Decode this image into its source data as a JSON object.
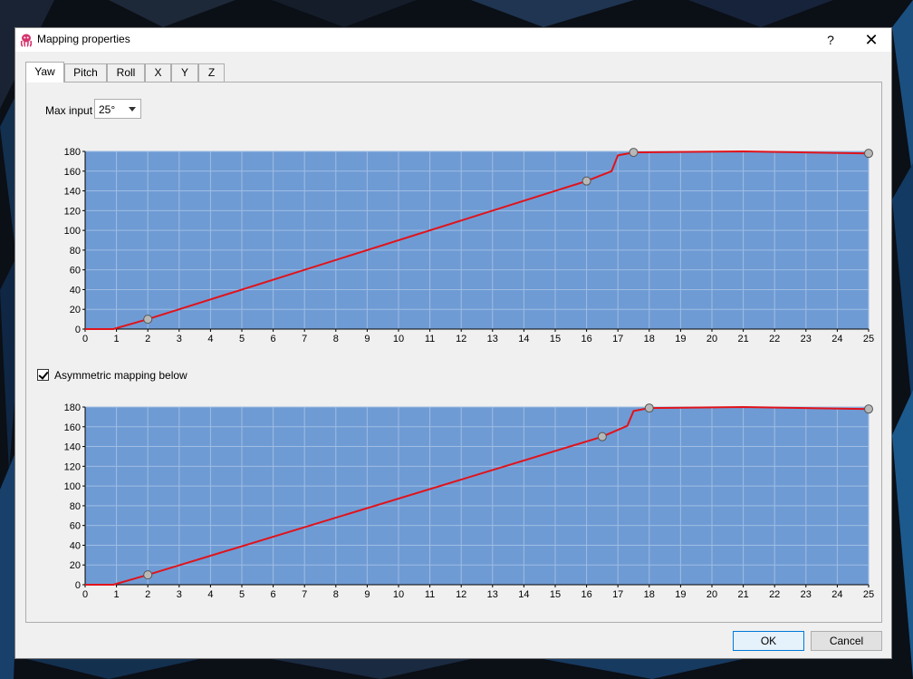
{
  "window": {
    "title": "Mapping properties",
    "help_label": "?",
    "close_label": "✕"
  },
  "tabs": [
    {
      "label": "Yaw",
      "active": true
    },
    {
      "label": "Pitch",
      "active": false
    },
    {
      "label": "Roll",
      "active": false
    },
    {
      "label": "X",
      "active": false
    },
    {
      "label": "Y",
      "active": false
    },
    {
      "label": "Z",
      "active": false
    }
  ],
  "max_input": {
    "label": "Max input",
    "value": "25°"
  },
  "asymmetric": {
    "label": "Asymmetric mapping below",
    "checked": true
  },
  "buttons": {
    "ok": "OK",
    "cancel": "Cancel"
  },
  "colors": {
    "plot_bg": "#6f9bd4",
    "curve": "#e0131b",
    "grid": "#9ebde4",
    "handle": "#b8b8b8"
  },
  "chart_data": [
    {
      "type": "line",
      "xlim": [
        0,
        25
      ],
      "ylim": [
        0,
        180
      ],
      "xticks": [
        0,
        1,
        2,
        3,
        4,
        5,
        6,
        7,
        8,
        9,
        10,
        11,
        12,
        13,
        14,
        15,
        16,
        17,
        18,
        19,
        20,
        21,
        22,
        23,
        24,
        25
      ],
      "yticks": [
        0,
        20,
        40,
        60,
        80,
        100,
        120,
        140,
        160,
        180
      ],
      "control_points": [
        {
          "x": 2,
          "y": 10
        },
        {
          "x": 16,
          "y": 150
        },
        {
          "x": 17.5,
          "y": 179
        },
        {
          "x": 25,
          "y": 178
        }
      ],
      "curve": [
        {
          "x": 0,
          "y": 0
        },
        {
          "x": 0.9,
          "y": 0
        },
        {
          "x": 2,
          "y": 10
        },
        {
          "x": 16,
          "y": 150
        },
        {
          "x": 16.8,
          "y": 160
        },
        {
          "x": 17.0,
          "y": 176
        },
        {
          "x": 17.5,
          "y": 179
        },
        {
          "x": 21,
          "y": 180
        },
        {
          "x": 25,
          "y": 178
        }
      ]
    },
    {
      "type": "line",
      "xlim": [
        0,
        25
      ],
      "ylim": [
        0,
        180
      ],
      "xticks": [
        0,
        1,
        2,
        3,
        4,
        5,
        6,
        7,
        8,
        9,
        10,
        11,
        12,
        13,
        14,
        15,
        16,
        17,
        18,
        19,
        20,
        21,
        22,
        23,
        24,
        25
      ],
      "yticks": [
        0,
        20,
        40,
        60,
        80,
        100,
        120,
        140,
        160,
        180
      ],
      "control_points": [
        {
          "x": 2,
          "y": 10
        },
        {
          "x": 16.5,
          "y": 150
        },
        {
          "x": 18,
          "y": 179
        },
        {
          "x": 25,
          "y": 178
        }
      ],
      "curve": [
        {
          "x": 0,
          "y": 0
        },
        {
          "x": 0.9,
          "y": 0
        },
        {
          "x": 2,
          "y": 10
        },
        {
          "x": 16.5,
          "y": 150
        },
        {
          "x": 17.3,
          "y": 161
        },
        {
          "x": 17.5,
          "y": 176
        },
        {
          "x": 18,
          "y": 179
        },
        {
          "x": 21,
          "y": 180
        },
        {
          "x": 25,
          "y": 178
        }
      ]
    }
  ]
}
